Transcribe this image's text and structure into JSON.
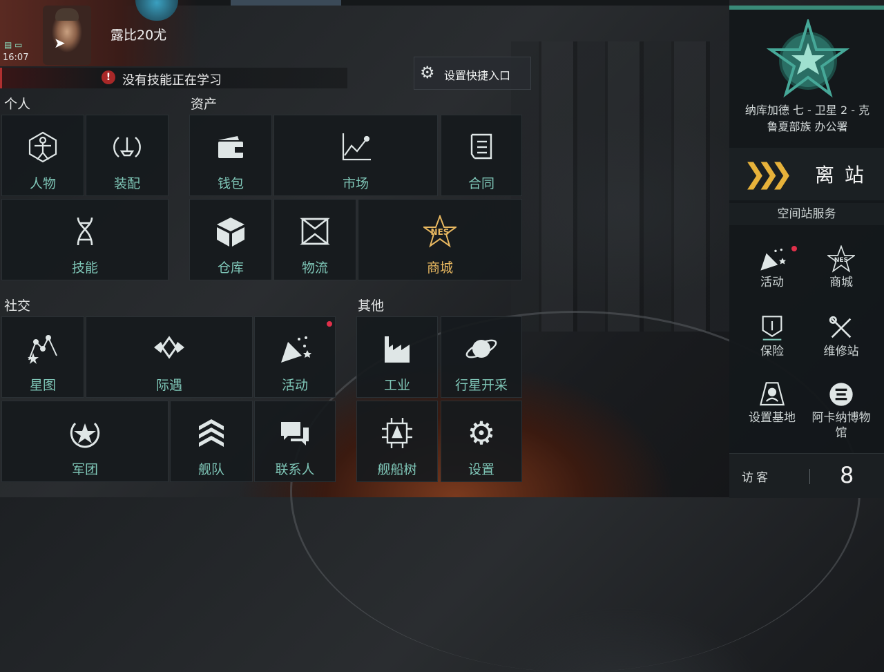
{
  "profile": {
    "character_name": "露比20尤",
    "clock": "16:07"
  },
  "skill_queue": {
    "status_text": "没有技能正在学习"
  },
  "quick_entry": {
    "label": "设置快捷入口"
  },
  "sections": {
    "personal": "个人",
    "assets": "资产",
    "social": "社交",
    "other": "其他"
  },
  "tiles": {
    "character": "人物",
    "fitting": "装配",
    "skills": "技能",
    "wallet": "钱包",
    "market": "市场",
    "contracts": "合同",
    "hangar": "仓库",
    "logistics": "物流",
    "store": "商城",
    "starmap": "星图",
    "encounters": "际遇",
    "events": "活动",
    "legion": "军团",
    "fleet": "舰队",
    "contacts": "联系人",
    "industry": "工业",
    "planetary_mining": "行星开采",
    "ship_tree": "舰船树",
    "settings": "设置"
  },
  "station": {
    "name_line1": "纳库加德 七 - 卫星 2 - 克",
    "name_line2": "鲁夏部族 办公署",
    "undock_label": "离 站",
    "services_title": "空间站服务",
    "services": {
      "events": "活动",
      "store": "商城",
      "insurance": "保险",
      "repair": "维修站",
      "set_home": "设置基地",
      "museum_line1": "阿卡纳博物",
      "museum_line2": "馆"
    },
    "visitor_label": "访客",
    "visitor_count": "8"
  },
  "colors": {
    "accent": "#7fc7b8",
    "gold": "#e8b860",
    "alert": "#e0304a",
    "undock_chevron": "#e7b23a"
  },
  "icons": {
    "character": "vitruvian-icon",
    "fitting": "fitting-icon",
    "skills": "dna-icon",
    "wallet": "wallet-icon",
    "market": "chart-line-icon",
    "contracts": "scroll-icon",
    "hangar": "cube-icon",
    "logistics": "box-frame-icon",
    "store": "nes-star-icon",
    "starmap": "constellation-icon",
    "encounters": "encounter-icon",
    "events": "party-popper-icon",
    "legion": "star-badge-icon",
    "fleet": "chevrons-icon",
    "contacts": "chat-bubbles-icon",
    "industry": "factory-icon",
    "planetary_mining": "planet-icon",
    "ship_tree": "ship-tree-icon",
    "settings": "gear-icon"
  }
}
